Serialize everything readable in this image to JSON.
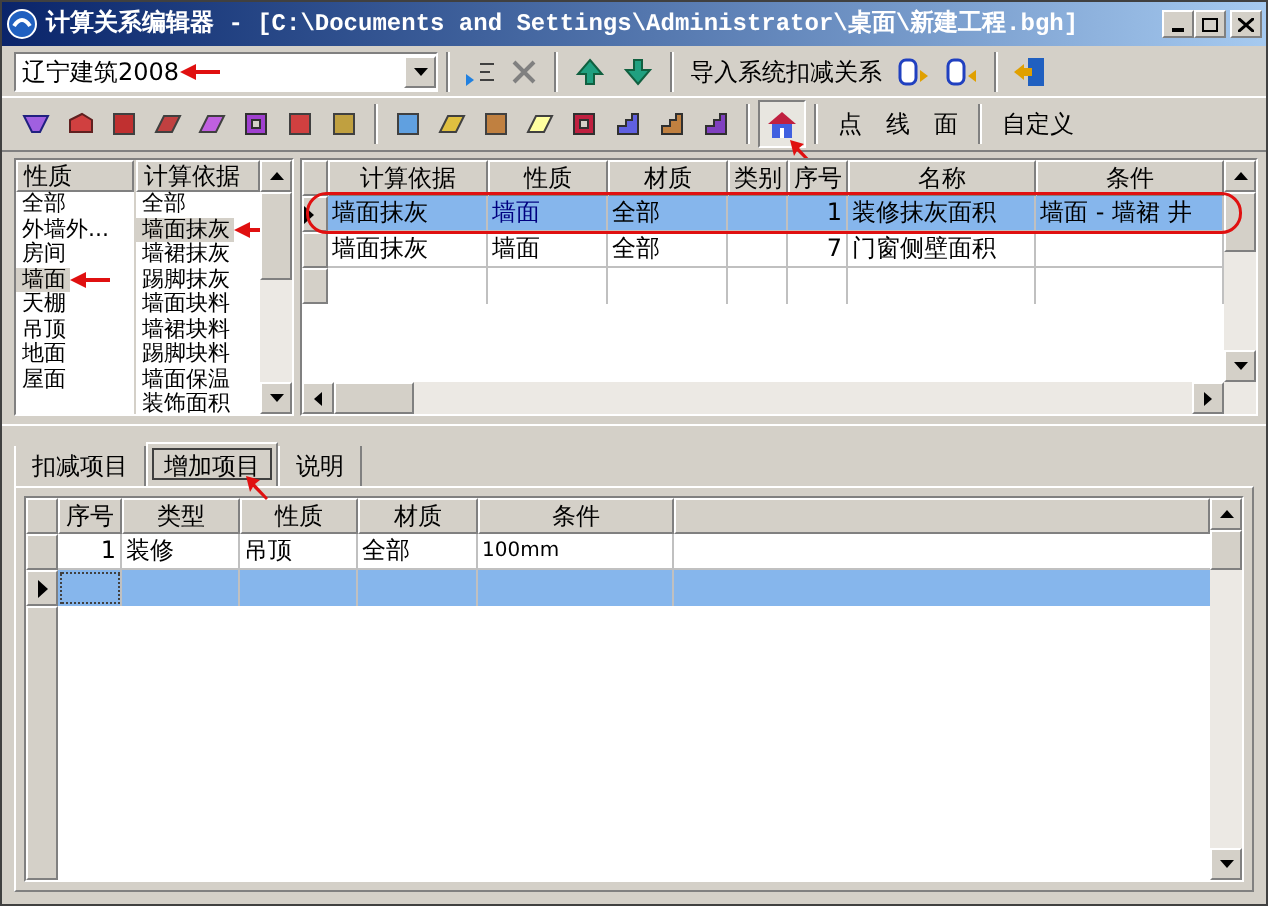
{
  "window": {
    "title": "计算关系编辑器 - [C:\\Documents and Settings\\Administrator\\桌面\\新建工程.bgh]"
  },
  "toolbar": {
    "region_select": {
      "value": "辽宁建筑2008"
    },
    "import_button": "导入系统扣减关系"
  },
  "filter_toolbar": {
    "house_pressed": true,
    "buttons": [
      "点",
      "线",
      "面",
      "自定义"
    ]
  },
  "property_list": {
    "header": "性质",
    "items": [
      {
        "label": "全部",
        "selected": false
      },
      {
        "label": "外墙外...",
        "selected": false
      },
      {
        "label": "房间",
        "selected": false
      },
      {
        "label": "墙面",
        "selected": true
      },
      {
        "label": "天棚",
        "selected": false
      },
      {
        "label": "吊顶",
        "selected": false
      },
      {
        "label": "地面",
        "selected": false
      },
      {
        "label": "屋面",
        "selected": false
      }
    ]
  },
  "basis_list": {
    "header": "计算依据",
    "items": [
      {
        "label": "全部",
        "selected": false
      },
      {
        "label": "墙面抹灰",
        "selected": true
      },
      {
        "label": "墙裙抹灰",
        "selected": false
      },
      {
        "label": "踢脚抹灰",
        "selected": false
      },
      {
        "label": "墙面块料",
        "selected": false
      },
      {
        "label": "墙裙块料",
        "selected": false
      },
      {
        "label": "踢脚块料",
        "selected": false
      },
      {
        "label": "墙面保温",
        "selected": false
      },
      {
        "label": "装饰面积",
        "selected": false
      }
    ]
  },
  "relations_table": {
    "columns": [
      "计算依据",
      "性质",
      "材质",
      "类别",
      "序号",
      "名称",
      "条件"
    ],
    "rows": [
      {
        "basis": "墙面抹灰",
        "property": "墙面",
        "material": "全部",
        "number": "1",
        "name": "装修抹灰面积",
        "condition": "墙面 - 墙裙 井",
        "selected": true
      },
      {
        "basis": "墙面抹灰",
        "property": "墙面",
        "material": "全部",
        "number": "7",
        "name": "门窗侧壁面积",
        "selected": false
      }
    ]
  },
  "bottom_tabs": [
    {
      "label": "扣减项目",
      "selected": false
    },
    {
      "label": "增加项目",
      "selected": true
    },
    {
      "label": "说明",
      "selected": false
    }
  ],
  "items_table": {
    "columns": [
      "序号",
      "类型",
      "性质",
      "材质",
      "条件"
    ],
    "rows": [
      {
        "cells": [
          "1",
          "装修",
          "吊顶",
          "全部",
          "100mm"
        ],
        "selected": false
      }
    ],
    "new_row": {
      "selected": true
    }
  }
}
